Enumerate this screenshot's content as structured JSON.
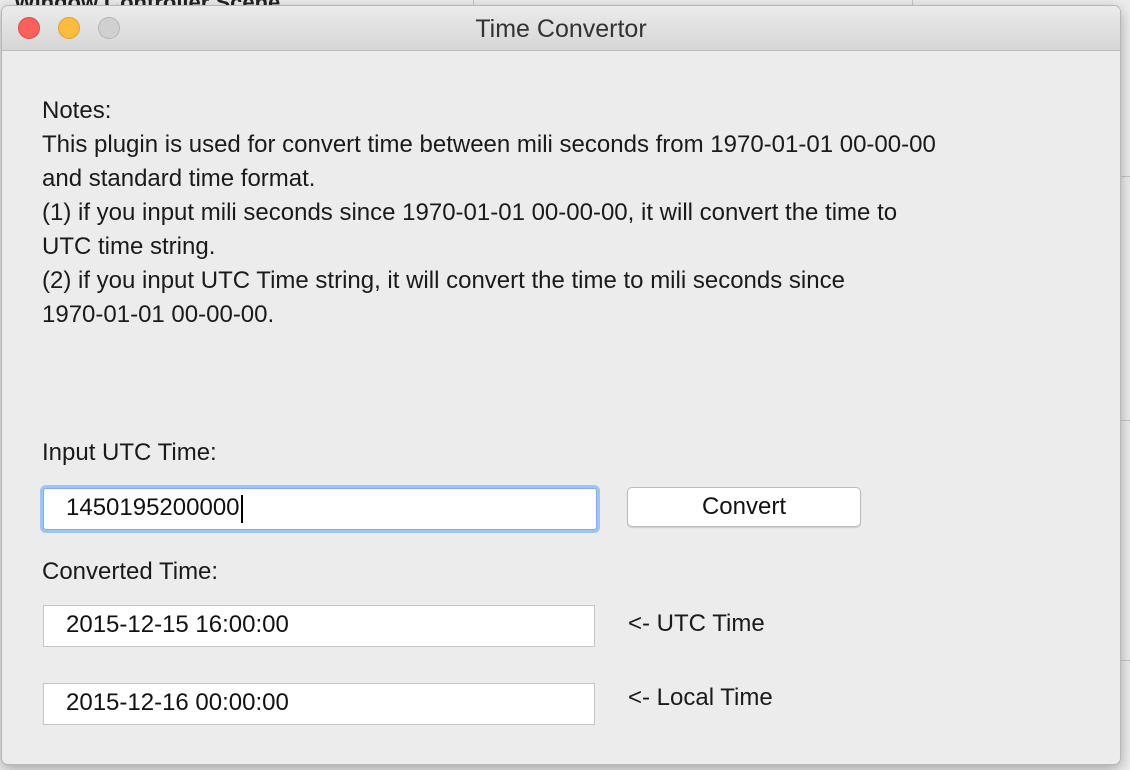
{
  "background_window": {
    "title": "Window Controller Scene"
  },
  "window": {
    "title": "Time Convertor"
  },
  "notes": {
    "lines": [
      "Notes:",
      "This plugin is used for convert time between mili seconds from 1970-01-01 00-00-00",
      "and standard time format.",
      "(1) if you input mili seconds since 1970-01-01 00-00-00,   it will convert the time to",
      "UTC time string.",
      "(2) if you input UTC Time string,   it will convert the time to mili seconds since",
      "1970-01-01 00-00-00."
    ]
  },
  "input": {
    "label": "Input UTC Time:",
    "value": "1450195200000"
  },
  "convert_button": {
    "label": "Convert"
  },
  "output": {
    "label": "Converted Time:",
    "utc_value": "2015-12-15 16:00:00",
    "utc_label": "<- UTC Time",
    "local_value": "2015-12-16 00:00:00",
    "local_label": "<- Local Time"
  }
}
